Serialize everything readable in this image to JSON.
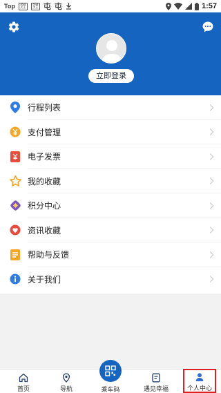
{
  "status_bar": {
    "app_label": "Top",
    "boxed_glyph_1": "奔驰大王",
    "boxed_glyph_2": "奔驰大王",
    "glyph_1": "屯",
    "glyph_2": "屯",
    "time": "1:57"
  },
  "header": {
    "login_button": "立即登录"
  },
  "menu": {
    "items": [
      {
        "label": "行程列表",
        "icon": "location-pin-icon",
        "color": "#2f7be5"
      },
      {
        "label": "支付管理",
        "icon": "yen-coin-icon",
        "color": "#f5a623"
      },
      {
        "label": "电子发票",
        "icon": "invoice-icon",
        "color": "#e74c3c"
      },
      {
        "label": "我的收藏",
        "icon": "star-icon",
        "color": "#f5a623"
      },
      {
        "label": "积分中心",
        "icon": "diamond-icon",
        "color": "#7e57c2"
      },
      {
        "label": "资讯收藏",
        "icon": "heart-icon",
        "color": "#e74c3c"
      },
      {
        "label": "帮助与反馈",
        "icon": "feedback-icon",
        "color": "#f5a623"
      },
      {
        "label": "关于我们",
        "icon": "info-icon",
        "color": "#2f7be5"
      }
    ]
  },
  "bottom_nav": {
    "home": "首页",
    "navigation": "导航",
    "ride_code": "乘车码",
    "meet_happiness": "遇见幸福",
    "profile": "个人中心"
  },
  "colors": {
    "brand_blue": "#1565c0",
    "active_outline": "#e02020"
  }
}
